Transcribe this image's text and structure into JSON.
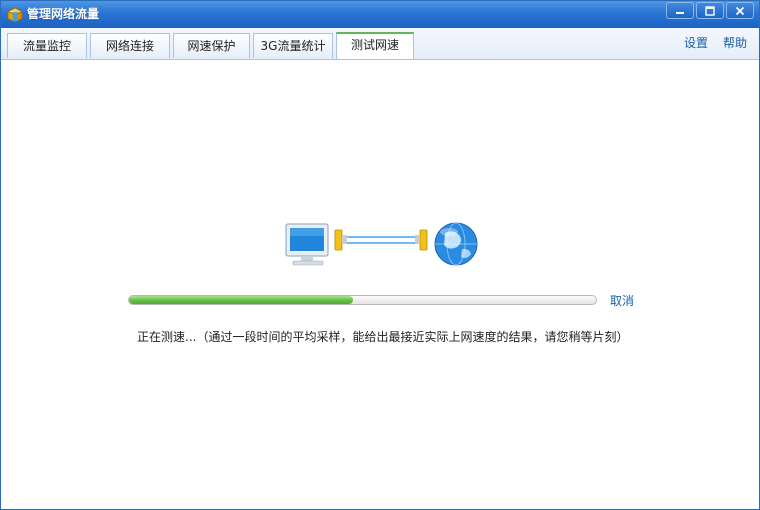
{
  "window": {
    "title": "管理网络流量",
    "accent": "#2a74d2"
  },
  "tabs": [
    {
      "label": "流量监控",
      "active": false
    },
    {
      "label": "网络连接",
      "active": false
    },
    {
      "label": "网速保护",
      "active": false
    },
    {
      "label": "3G流量统计",
      "active": false
    },
    {
      "label": "测试网速",
      "active": true
    }
  ],
  "links": {
    "settings": "设置",
    "help": "帮助"
  },
  "speedtest": {
    "progress": 0.48,
    "progress_color": "#6cc24a",
    "cancel_label": "取消",
    "status": "正在测速...（通过一段时间的平均采样，能给出最接近实际上网速度的结果，请您稍等片刻）"
  },
  "icons": [
    "app-icon",
    "minimize-icon",
    "maximize-icon",
    "close-icon",
    "computer-icon",
    "cable-icon",
    "globe-icon"
  ]
}
